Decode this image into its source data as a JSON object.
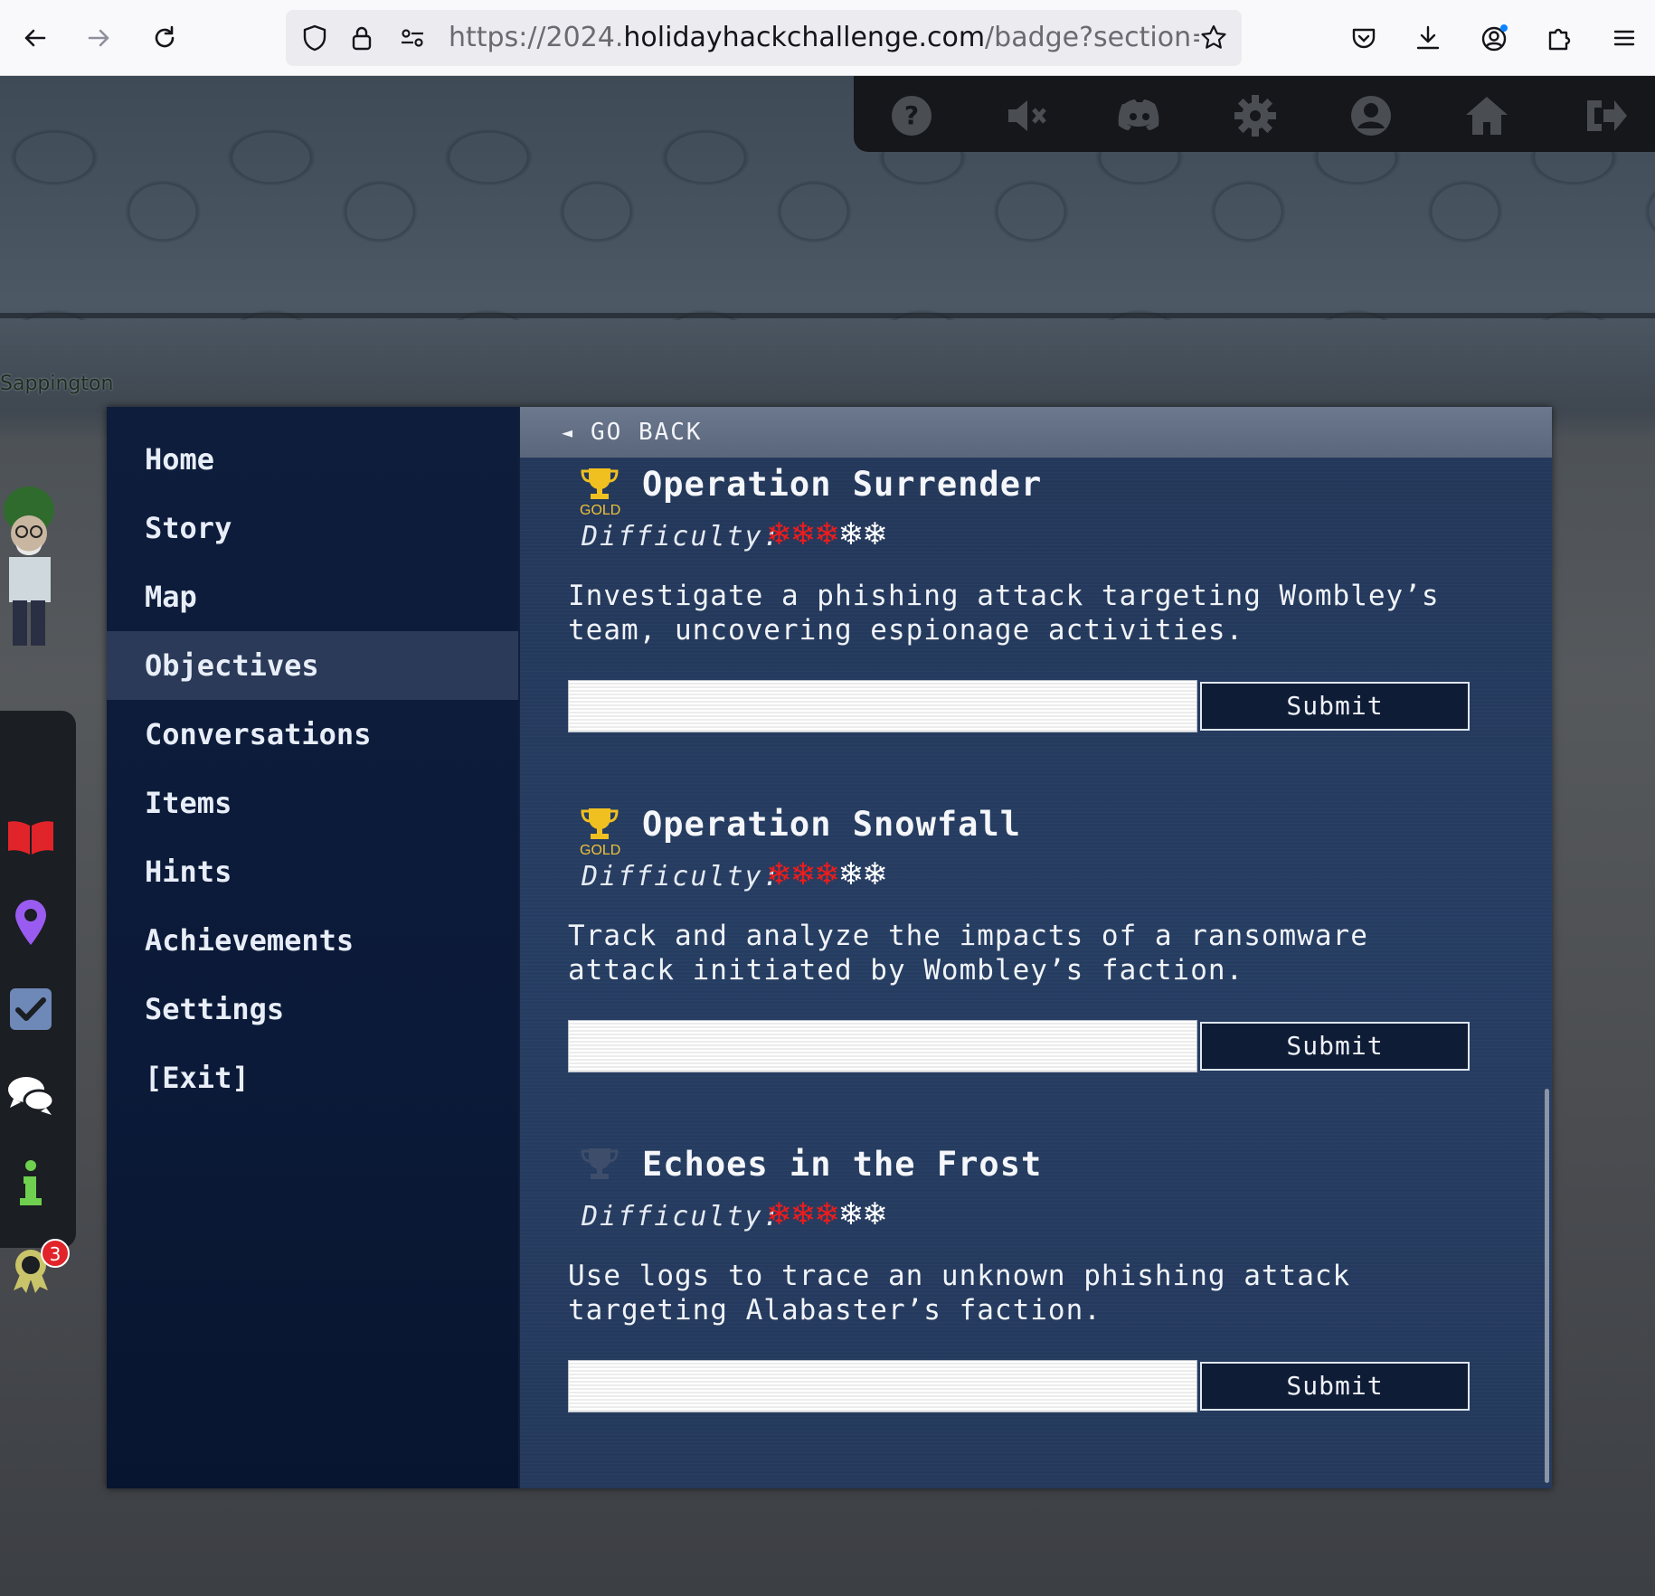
{
  "browser": {
    "url_prefix": "https://2024.",
    "url_host": "holidayhackchallenge.com",
    "url_path": "/badge?section=obj",
    "icons": [
      "back-arrow-icon",
      "forward-arrow-icon",
      "reload-icon",
      "shield-icon",
      "lock-icon",
      "permissions-icon",
      "bookmark-star-icon",
      "pocket-icon",
      "download-icon",
      "account-icon",
      "extensions-icon",
      "menu-icon"
    ]
  },
  "game": {
    "npc_name": "Sappington",
    "topbar_icons": [
      "help-icon",
      "mute-icon",
      "discord-icon",
      "settings-gear-icon",
      "profile-icon",
      "home-icon",
      "logout-icon"
    ],
    "left_toolbar_icons": [
      "badge-book-icon",
      "map-pin-icon",
      "objectives-check-icon",
      "chat-icon",
      "info-icon",
      "achievement-ribbon-icon"
    ],
    "achievement_badge_count": "3"
  },
  "sidenav": {
    "items": [
      {
        "label": "Home"
      },
      {
        "label": "Story"
      },
      {
        "label": "Map"
      },
      {
        "label": "Objectives",
        "active": true
      },
      {
        "label": "Conversations"
      },
      {
        "label": "Items"
      },
      {
        "label": "Hints"
      },
      {
        "label": "Achievements"
      },
      {
        "label": "Settings"
      },
      {
        "label": "[Exit]"
      }
    ]
  },
  "content": {
    "go_back_arrow": "◄",
    "go_back_label": "GO BACK",
    "submit_label": "Submit",
    "difficulty_label": "Difficulty:",
    "objectives": [
      {
        "title": "Operation Surrender",
        "tier": "GOLD",
        "trophy_color": "#f0c020",
        "difficulty": 3,
        "difficulty_max": 5,
        "description": "Investigate a phishing attack targeting Wombley’s team, uncovering espionage activities.",
        "answer": ""
      },
      {
        "title": "Operation Snowfall",
        "tier": "GOLD",
        "trophy_color": "#f0c020",
        "difficulty": 3,
        "difficulty_max": 5,
        "description": "Track and analyze the impacts of a ransomware attack initiated by Wombley’s faction.",
        "answer": ""
      },
      {
        "title": "Echoes in the Frost",
        "tier": "",
        "trophy_color": "#3e4e6a",
        "difficulty": 3,
        "difficulty_max": 5,
        "description": "Use logs to trace an unknown phishing attack targeting Alabaster’s faction.",
        "answer": ""
      }
    ]
  },
  "colors": {
    "difficulty_on": "#ee1c1c",
    "difficulty_off": "#ffffff",
    "active_nav": "#2a3a58",
    "gold": "#f0c23a"
  }
}
